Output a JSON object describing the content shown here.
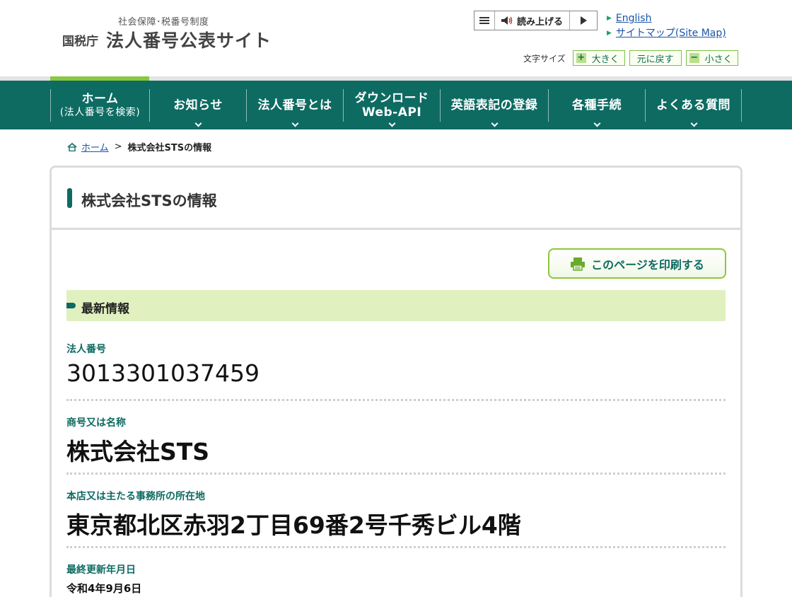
{
  "header": {
    "logo_sub": "社会保障･税番号制度",
    "logo_agency": "国税庁",
    "logo_title": "法人番号公表サイト",
    "readspeaker_label": "読み上げる",
    "links": [
      {
        "label": "English"
      },
      {
        "label": "サイトマップ(Site Map)"
      }
    ],
    "font_size": {
      "label": "文字サイズ",
      "bigger": "大きく",
      "reset": "元に戻す",
      "smaller": "小さく"
    }
  },
  "nav": {
    "items": [
      {
        "label": "ホーム",
        "sub": "(法人番号を検索)"
      },
      {
        "label": "お知らせ"
      },
      {
        "label": "法人番号とは"
      },
      {
        "label": "ダウンロード",
        "sub": "Web-API"
      },
      {
        "label": "英語表記の登録"
      },
      {
        "label": "各種手続"
      },
      {
        "label": "よくある質問"
      }
    ]
  },
  "breadcrumb": {
    "home": "ホーム",
    "separator": ">",
    "current": "株式会社STSの情報"
  },
  "page": {
    "title": "株式会社STSの情報",
    "print_label": "このページを印刷する",
    "section_title": "最新情報",
    "fields": [
      {
        "label": "法人番号",
        "value": "3013301037459"
      },
      {
        "label": "商号又は名称",
        "value": "株式会社STS"
      },
      {
        "label": "本店又は主たる事務所の所在地",
        "value": "東京都北区赤羽2丁目69番2号千秀ビル4階"
      },
      {
        "label": "最終更新年月日",
        "value": "令和4年9月6日"
      }
    ]
  },
  "colors": {
    "nav_bg": "#0d6b62",
    "accent_green": "#8cc63f",
    "section_band": "#e0f0bf",
    "link_blue": "#1a53a8"
  }
}
